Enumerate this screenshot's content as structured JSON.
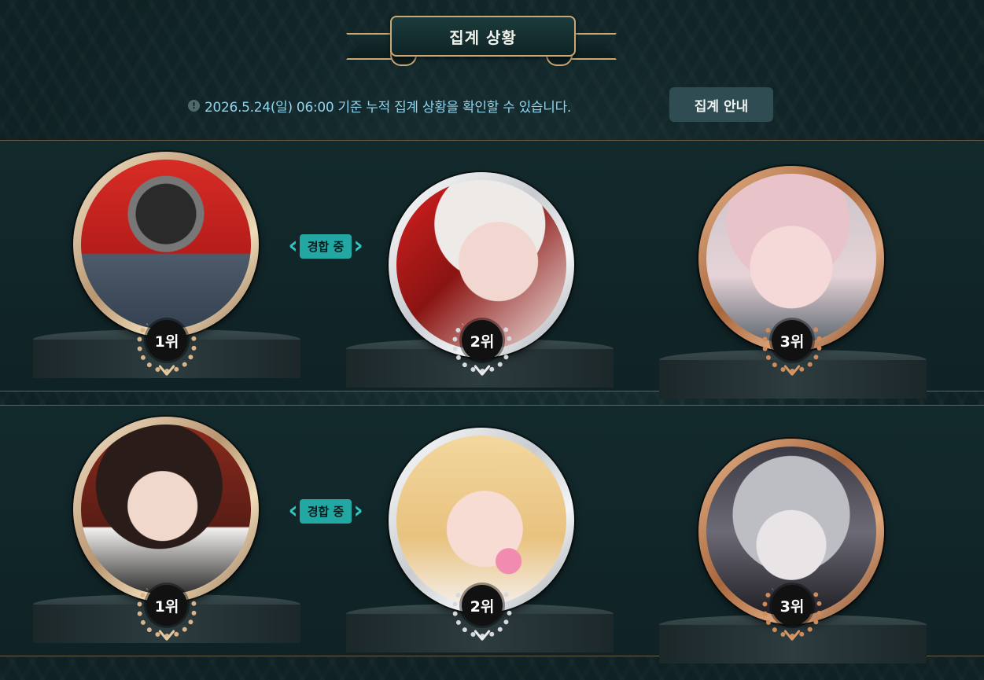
{
  "header": {
    "title": "집계 상황",
    "notice_icon": "!",
    "notice_text": "2026.5.24(일) 06:00 기준 누적 집계 상황을 확인할 수 있습니다.",
    "guide_button": "집계 안내"
  },
  "contest_label": "경합 중",
  "stages": [
    {
      "contest_between": [
        1,
        2
      ],
      "entries": [
        {
          "rank_label": "1위",
          "frame": "gold",
          "art": "camera-head-character"
        },
        {
          "rank_label": "2위",
          "frame": "silver",
          "art": "white-hair-horned-character"
        },
        {
          "rank_label": "3위",
          "frame": "bronze",
          "art": "pink-hair-beanie-character"
        }
      ]
    },
    {
      "contest_between": [
        1,
        2
      ],
      "entries": [
        {
          "rank_label": "1위",
          "frame": "gold",
          "art": "dark-hair-woman-character"
        },
        {
          "rank_label": "2위",
          "frame": "silver",
          "art": "blonde-bubblegum-character"
        },
        {
          "rank_label": "3위",
          "frame": "bronze",
          "art": "silver-hair-dragon-hood-character"
        }
      ]
    }
  ],
  "colors": {
    "background": "#0f2124",
    "notice_text": "#8fd4ec",
    "contest_accent": "#23a7a3",
    "gold": "#d8b48a",
    "silver": "#d6d9dc",
    "bronze": "#d08b5a"
  }
}
